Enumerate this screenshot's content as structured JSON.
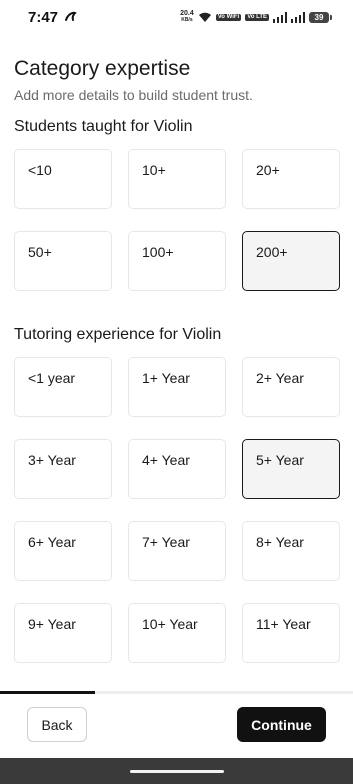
{
  "status_bar": {
    "time": "7:47",
    "net_speed_value": "20.4",
    "net_speed_unit": "KB/s",
    "sim1_label": "Vo WiFi",
    "sim2_label": "Vo LTE",
    "battery": "39"
  },
  "page": {
    "title": "Category expertise",
    "subtitle": "Add more details to build student trust."
  },
  "students_section": {
    "heading": "Students taught for Violin",
    "options": [
      "<10",
      "10+",
      "20+",
      "50+",
      "100+",
      "200+"
    ],
    "selected": "200+"
  },
  "experience_section": {
    "heading": "Tutoring experience for Violin",
    "options": [
      "<1 year",
      "1+ Year",
      "2+ Year",
      "3+ Year",
      "4+ Year",
      "5+ Year",
      "6+ Year",
      "7+ Year",
      "8+ Year",
      "9+ Year",
      "10+ Year",
      "11+ Year"
    ],
    "selected": "5+ Year"
  },
  "progress": {
    "fraction": 0.27
  },
  "footer": {
    "back_label": "Back",
    "continue_label": "Continue"
  },
  "colors": {
    "accent": "#111111",
    "selected_bg": "#f4f4f4",
    "border": "#e7e7e7",
    "subtitle": "#6b6b6b"
  }
}
